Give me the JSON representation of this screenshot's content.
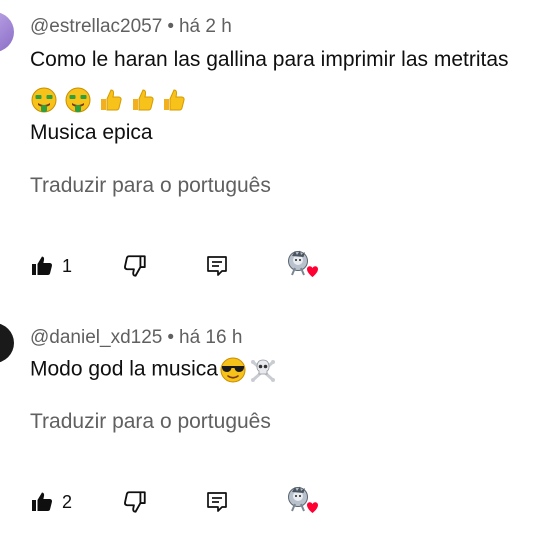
{
  "comments": [
    {
      "author": "@estrellac2057",
      "separator": "•",
      "time": "há 2 h",
      "line1": "Como le haran las gallina para imprimir las metritas",
      "line2_emojis": [
        "money-mouth-face",
        "money-mouth-face",
        "thumbs-up",
        "thumbs-up",
        "thumbs-up"
      ],
      "line3": "Musica epica",
      "translate": "Traduzir para o português",
      "likes": "1",
      "avatar_color": "#9b7fd0"
    },
    {
      "author": "@daniel_xd125",
      "separator": "•",
      "time": "há 16 h",
      "line1": "Modo god la musica",
      "line1_emojis": [
        "smiling-face-with-sunglasses",
        "skull-and-crossbones"
      ],
      "translate": "Traduzir para o português",
      "likes": "2",
      "avatar_color": "#1a1a1a"
    }
  ],
  "icons": {
    "like": "thumbs-up-filled-icon",
    "dislike": "thumbs-down-outline-icon",
    "reply": "reply-comment-icon",
    "creator_heart": "creator-heart-icon"
  },
  "colors": {
    "text_primary": "#0f0f0f",
    "text_secondary": "#606060",
    "heart": "#ff0033"
  }
}
